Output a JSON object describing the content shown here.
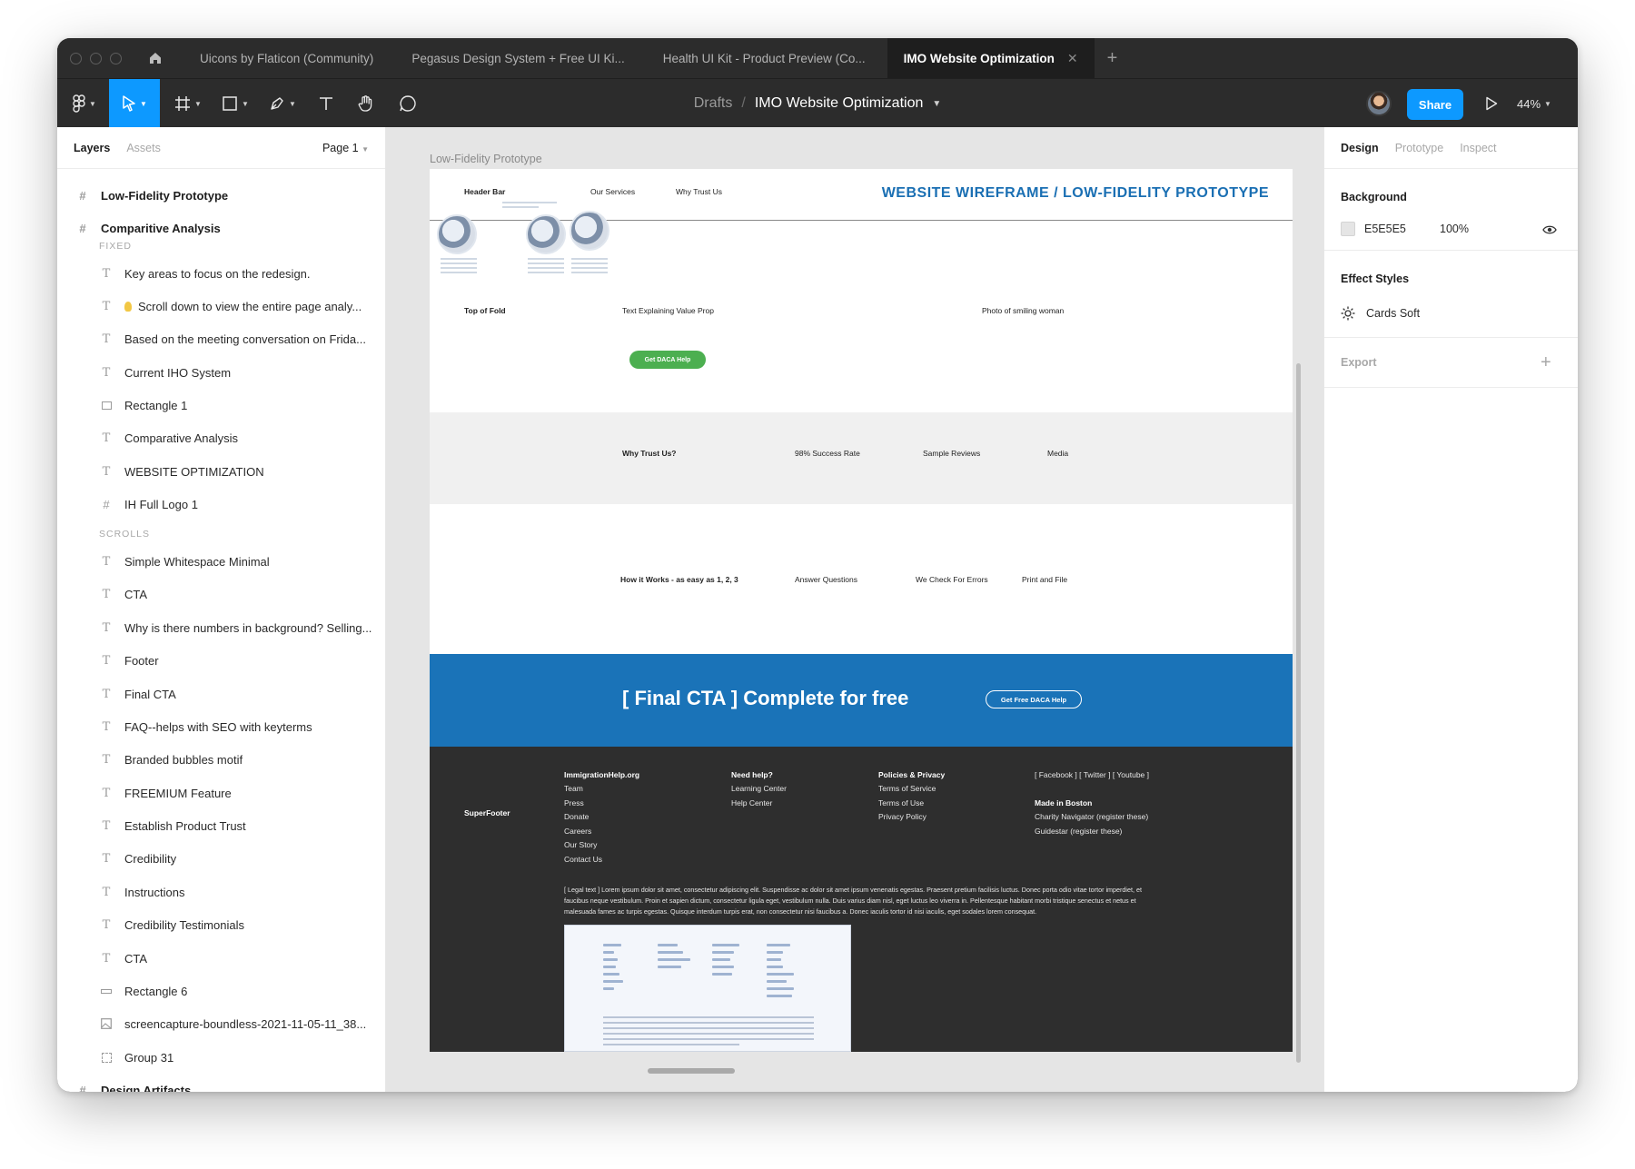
{
  "tabs": [
    {
      "label": "Uicons by Flaticon (Community)"
    },
    {
      "label": "Pegasus Design System + Free UI Ki..."
    },
    {
      "label": "Health UI Kit - Product Preview (Co..."
    },
    {
      "label": "IMO Website Optimization"
    }
  ],
  "toolbar": {
    "breadcrumb_root": "Drafts",
    "breadcrumb_sep": "/",
    "file_name": "IMO Website Optimization",
    "share_label": "Share",
    "zoom": "44%"
  },
  "left_panel": {
    "tab_layers": "Layers",
    "tab_assets": "Assets",
    "page": "Page 1",
    "section_fixed": "FIXED",
    "section_scrolls": "SCROLLS",
    "frames": [
      {
        "label": "Low-Fidelity Prototype"
      },
      {
        "label": "Comparitive Analysis"
      },
      {
        "label": "Design Artifacts"
      }
    ],
    "fixed_items": [
      {
        "label": "Key areas to focus on the redesign.",
        "icon": "text-icon"
      },
      {
        "label": "Scroll down to view the entire page analy...",
        "icon": "text-icon"
      },
      {
        "label": "Based on the meeting conversation on Frida...",
        "icon": "text-icon"
      },
      {
        "label": "Current IHO System",
        "icon": "text-icon"
      },
      {
        "label": "Rectangle 1",
        "icon": "rectangle-icon"
      },
      {
        "label": "Comparative Analysis",
        "icon": "text-icon"
      },
      {
        "label": "WEBSITE OPTIMIZATION",
        "icon": "text-icon"
      },
      {
        "label": "IH Full Logo 1",
        "icon": "frame-icon"
      }
    ],
    "scroll_items": [
      {
        "label": "Simple Whitespace Minimal",
        "icon": "text-icon"
      },
      {
        "label": "CTA",
        "icon": "text-icon"
      },
      {
        "label": "Why is there numbers in background? Selling...",
        "icon": "text-icon"
      },
      {
        "label": "Footer",
        "icon": "text-icon"
      },
      {
        "label": "Final CTA",
        "icon": "text-icon"
      },
      {
        "label": "FAQ--helps with SEO with keyterms",
        "icon": "text-icon"
      },
      {
        "label": "Branded bubbles motif",
        "icon": "text-icon"
      },
      {
        "label": "FREEMIUM Feature",
        "icon": "text-icon"
      },
      {
        "label": "Establish Product Trust",
        "icon": "text-icon"
      },
      {
        "label": "Credibility",
        "icon": "text-icon"
      },
      {
        "label": "Instructions",
        "icon": "text-icon"
      },
      {
        "label": "Credibility Testimonials",
        "icon": "text-icon"
      },
      {
        "label": "CTA",
        "icon": "text-icon"
      },
      {
        "label": "Rectangle 6",
        "icon": "rectangle-icon"
      },
      {
        "label": "screencapture-boundless-2021-11-05-11_38...",
        "icon": "image-icon"
      },
      {
        "label": "Group 31",
        "icon": "group-icon"
      }
    ]
  },
  "canvas": {
    "frame_label": "Low-Fidelity Prototype",
    "wireframe": {
      "header_bar": "Header Bar",
      "our_services": "Our Services",
      "why_trust_us_nav": "Why Trust Us",
      "title": "WEBSITE WIREFRAME / LOW-FIDELITY PROTOTYPE",
      "top_of_fold": "Top of Fold",
      "value_prop": "Text Explaining Value Prop",
      "photo": "Photo of smiling woman",
      "cta_button": "Get DACA Help",
      "why_trust": "Why Trust Us?",
      "success_rate": "98% Success Rate",
      "sample_reviews": "Sample Reviews",
      "media": "Media",
      "how_it_works": "How it Works - as easy as 1, 2, 3",
      "answer_questions": "Answer Questions",
      "check_errors": "We Check For Errors",
      "print_file": "Print and File",
      "final_cta": "[ Final CTA ] Complete for free",
      "final_cta_button": "Get Free DACA Help",
      "footer": {
        "superfooter": "SuperFooter",
        "col1": [
          "ImmigrationHelp.org",
          "Team",
          "Press",
          "Donate",
          "Careers",
          "Our Story",
          "Contact Us"
        ],
        "col2": [
          "Need help?",
          "Learning Center",
          "Help Center"
        ],
        "col3": [
          "Policies & Privacy",
          "Terms of Service",
          "Terms of Use",
          "Privacy Policy"
        ],
        "col4": [
          "[ Facebook ] [ Twitter ] [ Youtube ]",
          "Made in Boston",
          "Charity Navigator (register these)",
          "Guidestar (register these)"
        ],
        "legal": "[ Legal text ] Lorem ipsum dolor sit amet, consectetur adipiscing elit. Suspendisse ac dolor sit amet ipsum venenatis egestas. Praesent pretium facilisis luctus. Donec porta odio vitae tortor imperdiet, et faucibus neque vestibulum. Proin et sapien dictum, consectetur ligula eget, vestibulum nulla. Duis varius diam nisl, eget luctus leo viverra in. Pellentesque habitant morbi tristique senectus et netus et malesuada fames ac turpis egestas. Quisque interdum turpis erat, non consectetur nisi faucibus a. Donec iaculis tortor id nisi iaculis, eget sodales lorem consequat."
      }
    }
  },
  "right_panel": {
    "tab_design": "Design",
    "tab_prototype": "Prototype",
    "tab_inspect": "Inspect",
    "background_title": "Background",
    "background_hex": "E5E5E5",
    "background_opacity": "100%",
    "effect_styles_title": "Effect Styles",
    "effect_style": "Cards Soft",
    "export_title": "Export"
  },
  "help_label": "?",
  "colors": {
    "accent": "#0d99ff",
    "toolbar_bg": "#2c2c2c",
    "canvas_bg": "#e5e5e5",
    "cta_blue": "#1a73b8",
    "cta_green": "#4caf50",
    "title_blue": "#1a6fb3"
  }
}
